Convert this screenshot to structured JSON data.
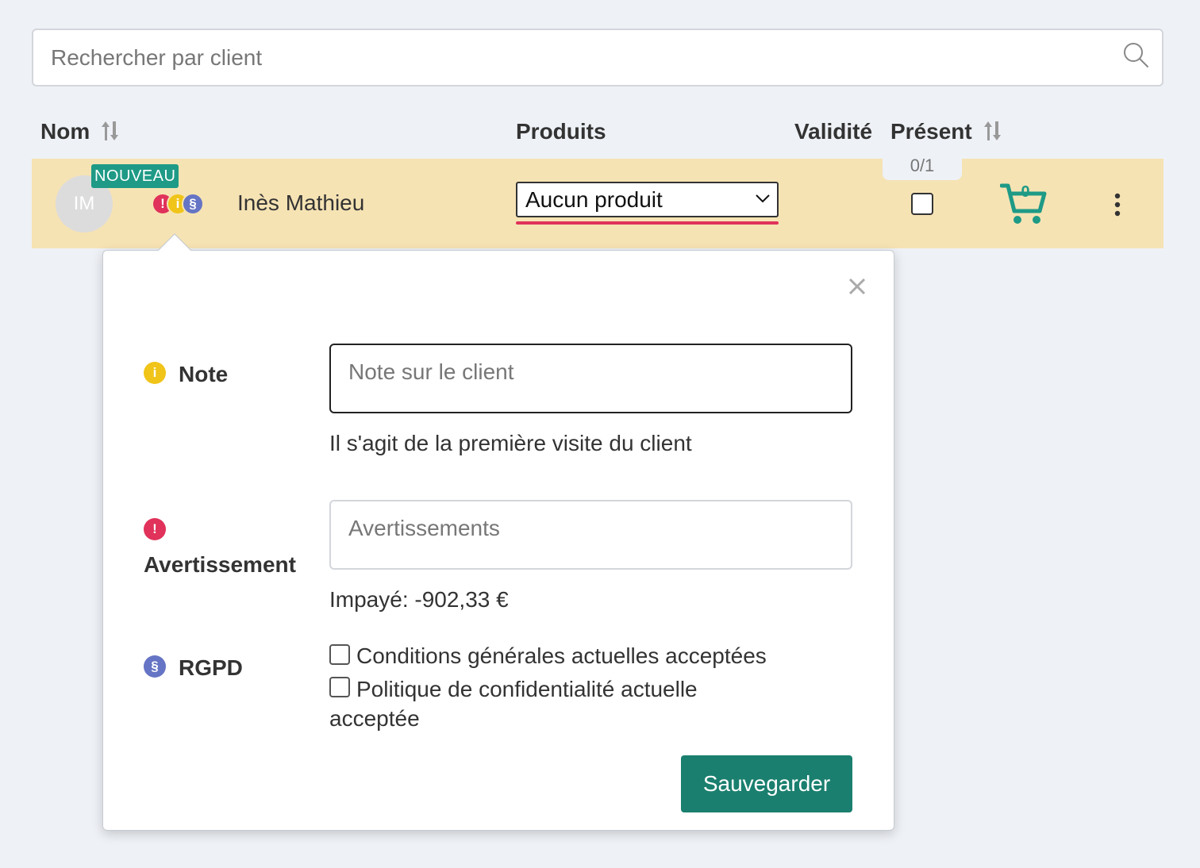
{
  "search": {
    "placeholder": "Rechercher par client",
    "value": ""
  },
  "table": {
    "headers": {
      "name": "Nom",
      "products": "Produits",
      "validity": "Validité",
      "present": "Présent"
    }
  },
  "client": {
    "initials": "IM",
    "badge": "NOUVEAU",
    "name": "Inès Mathieu",
    "status_icons": {
      "warning": "!",
      "info": "i",
      "gdpr": "§"
    },
    "product_select": "Aucun produit",
    "present_count": "0/1",
    "present_checked": false,
    "cart_count": "0"
  },
  "popover": {
    "note": {
      "label": "Note",
      "placeholder": "Note sur le client",
      "help": "Il s'agit de la première visite du client"
    },
    "warning": {
      "label": "Avertissement",
      "placeholder": "Avertissements",
      "help": "Impayé: -902,33 €"
    },
    "gdpr": {
      "label": "RGPD",
      "terms_label": "Conditions générales actuelles acceptées",
      "privacy_label_line1": "Politique de confidentialité actuelle",
      "privacy_label_line2": "acceptée"
    },
    "save_label": "Sauvegarder"
  },
  "icons": [
    "search-icon",
    "sort-icon",
    "chevron-down-icon",
    "cart-icon",
    "kebab-menu-icon",
    "close-icon",
    "info-icon",
    "warning-icon",
    "gdpr-icon"
  ],
  "colors": {
    "page_bg": "#eef1f6",
    "row_highlight": "#f6e3b4",
    "brand_teal": "#1e9a86",
    "save_button": "#1a7f6e",
    "warning_red": "#e0325a",
    "info_yellow": "#f0c419",
    "gdpr_purple": "#6574c4"
  }
}
